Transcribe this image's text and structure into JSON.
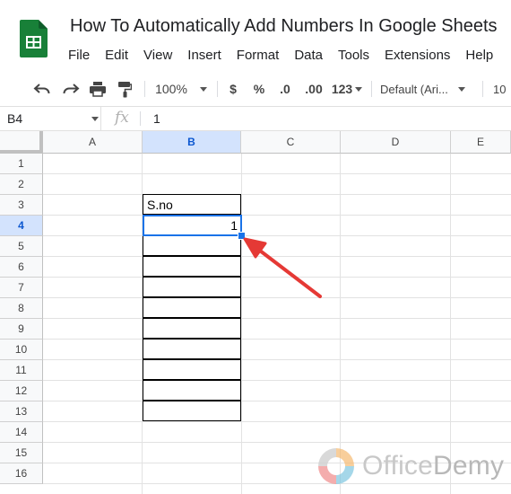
{
  "window": {
    "doc_title": "How To Automatically Add Numbers In Google Sheets"
  },
  "menu": {
    "items": [
      "File",
      "Edit",
      "View",
      "Insert",
      "Format",
      "Data",
      "Tools",
      "Extensions",
      "Help"
    ]
  },
  "toolbar": {
    "zoom": "100%",
    "currency": "$",
    "percent": "%",
    "decrease_decimals": ".0",
    "increase_decimals": ".00",
    "number_format": "123",
    "font": "Default (Ari...",
    "font_size": "10"
  },
  "formula_bar": {
    "cell_ref": "B4",
    "fx_label": "fx",
    "value": "1"
  },
  "sheet": {
    "columns": [
      "A",
      "B",
      "C",
      "D",
      "E"
    ],
    "active_column": "B",
    "rows": [
      "1",
      "2",
      "3",
      "4",
      "5",
      "6",
      "7",
      "8",
      "9",
      "10",
      "11",
      "12",
      "13",
      "14",
      "15",
      "16"
    ],
    "active_row": "4",
    "header_cell": "S.no",
    "selected_value": "1"
  },
  "watermark": {
    "brand_part1": "Office",
    "brand_part2": "Demy"
  },
  "colors": {
    "selection": "#1a73e8",
    "arrow": "#e53935",
    "sheets_green": "#188038"
  },
  "icons": [
    "sheets-logo-icon",
    "undo-icon",
    "redo-icon",
    "print-icon",
    "paint-format-icon"
  ]
}
